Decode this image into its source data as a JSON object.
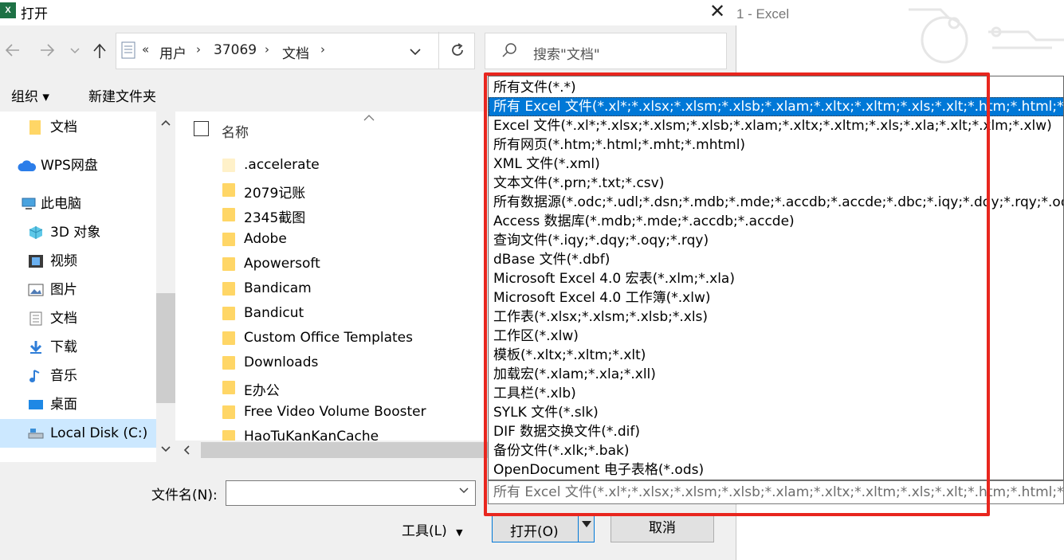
{
  "background_window": {
    "title": "1 - Excel"
  },
  "dialog": {
    "title": "打开",
    "close_symbol": "✕"
  },
  "nav": {
    "back_icon": "arrow-left-icon",
    "forward_icon": "arrow-right-icon",
    "recent_icon": "chevron-down-icon",
    "up_icon": "arrow-up-icon",
    "breadcrumb": [
      "用户",
      "37069",
      "文档"
    ],
    "overflow": "«",
    "refresh_icon": "refresh-icon"
  },
  "search": {
    "placeholder": "搜索\"文档\""
  },
  "toolbar": {
    "organize": "组织 ▾",
    "new_folder": "新建文件夹"
  },
  "sidebar": {
    "items": [
      {
        "label": "文档",
        "icon": "folder-icon"
      },
      {
        "label": "WPS网盘",
        "icon": "cloud-icon"
      },
      {
        "label": "此电脑",
        "icon": "computer-icon"
      },
      {
        "label": "3D 对象",
        "icon": "cube-icon"
      },
      {
        "label": "视频",
        "icon": "video-icon"
      },
      {
        "label": "图片",
        "icon": "picture-icon"
      },
      {
        "label": "文档",
        "icon": "document-icon"
      },
      {
        "label": "下载",
        "icon": "download-icon"
      },
      {
        "label": "音乐",
        "icon": "music-icon"
      },
      {
        "label": "桌面",
        "icon": "desktop-icon"
      },
      {
        "label": "Local Disk (C:)",
        "icon": "drive-icon"
      }
    ]
  },
  "files": {
    "column_name": "名称",
    "rows": [
      ".accelerate",
      "2079记账",
      "2345截图",
      "Adobe",
      "Apowersoft",
      "Bandicam",
      "Bandicut",
      "Custom Office Templates",
      "Downloads",
      "E办公",
      "Free Video Volume Booster",
      "HaoTuKanKanCache"
    ]
  },
  "bottom": {
    "filename_label": "文件名(N):",
    "filename_value": "",
    "tools": "工具(L)",
    "open": "打开(O)",
    "cancel": "取消"
  },
  "file_type": {
    "options": [
      "所有文件(*.*)",
      "所有 Excel 文件(*.xl*;*.xlsx;*.xlsm;*.xlsb;*.xlam;*.xltx;*.xltm;*.xls;*.xlt;*.htm;*.html;*.mht;*",
      "Excel 文件(*.xl*;*.xlsx;*.xlsm;*.xlsb;*.xlam;*.xltx;*.xltm;*.xls;*.xla;*.xlt;*.xlm;*.xlw)",
      "所有网页(*.htm;*.html;*.mht;*.mhtml)",
      "XML 文件(*.xml)",
      "文本文件(*.prn;*.txt;*.csv)",
      "所有数据源(*.odc;*.udl;*.dsn;*.mdb;*.mde;*.accdb;*.accde;*.dbc;*.iqy;*.dqy;*.rqy;*.oqy;",
      "Access 数据库(*.mdb;*.mde;*.accdb;*.accde)",
      "查询文件(*.iqy;*.dqy;*.oqy;*.rqy)",
      "dBase 文件(*.dbf)",
      "Microsoft Excel 4.0 宏表(*.xlm;*.xla)",
      "Microsoft Excel 4.0 工作簿(*.xlw)",
      "工作表(*.xlsx;*.xlsm;*.xlsb;*.xls)",
      "工作区(*.xlw)",
      "模板(*.xltx;*.xltm;*.xlt)",
      "加载宏(*.xlam;*.xla;*.xll)",
      "工具栏(*.xlb)",
      "SYLK 文件(*.slk)",
      "DIF 数据交换文件(*.dif)",
      "备份文件(*.xlk;*.bak)",
      "OpenDocument 电子表格(*.ods)"
    ],
    "selected_index": 1,
    "current": "所有 Excel 文件(*.xl*;*.xlsx;*.xlsm;*.xlsb;*.xlam;*.xltx;*.xltm;*.xls;*.xlt;*.htm;*.html;*.mht;*"
  },
  "colors": {
    "selection": "#0078d7",
    "highlight_box": "#e8261e",
    "excel_green": "#1e7145"
  }
}
